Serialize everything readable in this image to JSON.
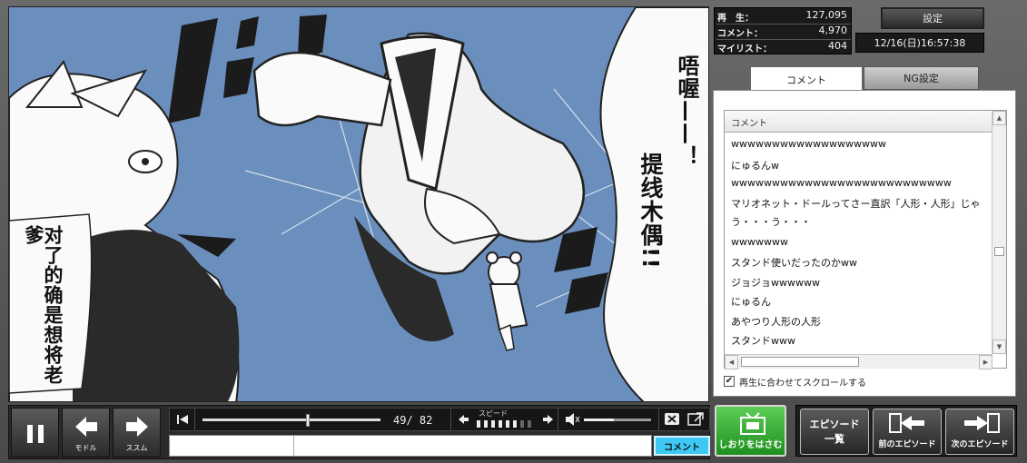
{
  "stats": {
    "views_label": "再　生：",
    "views_value": "127,095",
    "comments_label": "コメント：",
    "comments_value": "4,970",
    "mylist_label": "マイリスト：",
    "mylist_value": "404"
  },
  "header": {
    "settings_label": "設定",
    "datetime": "12/16(日)16:57:38"
  },
  "tabs": {
    "comment_label": "コメント",
    "ng_label": "NG設定"
  },
  "comment_list": {
    "column_header": "コメント",
    "items": [
      "wwwwwwwwwwwwwwwwwww",
      "にゅるんw",
      "wwwwwwwwwwwwwwwwwwwwwwwwwww",
      "マリオネット・ドールってさー直訳「人形・人形」じゃう・・・う・・・",
      "wwwwwww",
      "スタンド使いだったのかww",
      "ジョジョwwwwww",
      "にゅるん",
      "あやつり人形の人形",
      "スタンドwww"
    ],
    "sync_label": "再生に合わせてスクロールする",
    "sync_checked": true
  },
  "manga": {
    "bubble_a": "唔喔——！",
    "bubble_b": "提线木偶!!",
    "bubble_c": "对了的确是想将老爹"
  },
  "controls": {
    "pause_label": "",
    "back_label": "モドル",
    "forward_label": "ススム",
    "page_counter": "49/ 82",
    "current_page": 49,
    "total_pages": 82,
    "speed_label": "スピード",
    "speed_level": 6,
    "speed_max": 8,
    "volume_fraction": 0.45,
    "comment_submit_label": "コメント",
    "comment_input_value": ""
  },
  "actions": {
    "bookmark_label": "しおりをはさむ",
    "episode_list_label_line1": "エピソード",
    "episode_list_label_line2": "一覧",
    "prev_episode_label": "前のエピソード",
    "next_episode_label": "次のエピソード"
  },
  "colors": {
    "panel_blue": "#6b8fbd",
    "bookmark_green": "#3aa83a",
    "comment_button": "#3ec9f5"
  }
}
